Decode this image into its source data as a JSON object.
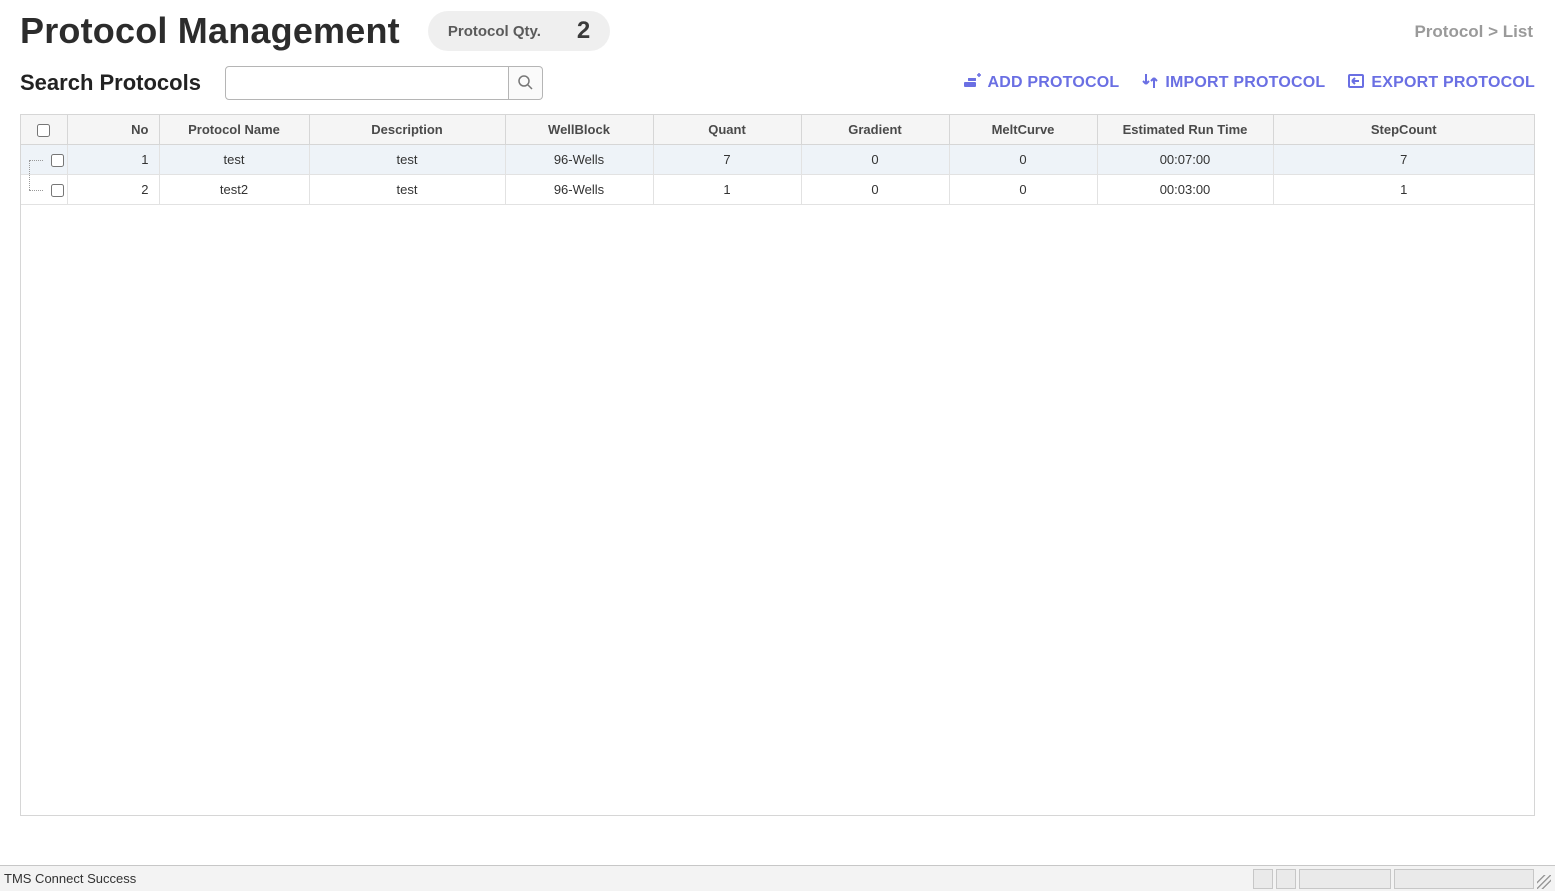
{
  "header": {
    "title": "Protocol Management",
    "qty_label": "Protocol Qty.",
    "qty_value": "2"
  },
  "breadcrumb": "Protocol > List",
  "search": {
    "label": "Search Protocols",
    "value": "",
    "placeholder": ""
  },
  "actions": {
    "add": "ADD PROTOCOL",
    "import": "IMPORT PROTOCOL",
    "export": "EXPORT PROTOCOL"
  },
  "table": {
    "columns": [
      "No",
      "Protocol Name",
      "Description",
      "WellBlock",
      "Quant",
      "Gradient",
      "MeltCurve",
      "Estimated Run Time",
      "StepCount"
    ],
    "rows": [
      {
        "no": "1",
        "name": "test",
        "description": "test",
        "wellblock": "96-Wells",
        "quant": "7",
        "gradient": "0",
        "meltcurve": "0",
        "runtime": "00:07:00",
        "stepcount": "7",
        "highlight": true
      },
      {
        "no": "2",
        "name": "test2",
        "description": "test",
        "wellblock": "96-Wells",
        "quant": "1",
        "gradient": "0",
        "meltcurve": "0",
        "runtime": "00:03:00",
        "stepcount": "1",
        "highlight": false
      }
    ]
  },
  "statusbar": {
    "message": "TMS Connect Success"
  }
}
